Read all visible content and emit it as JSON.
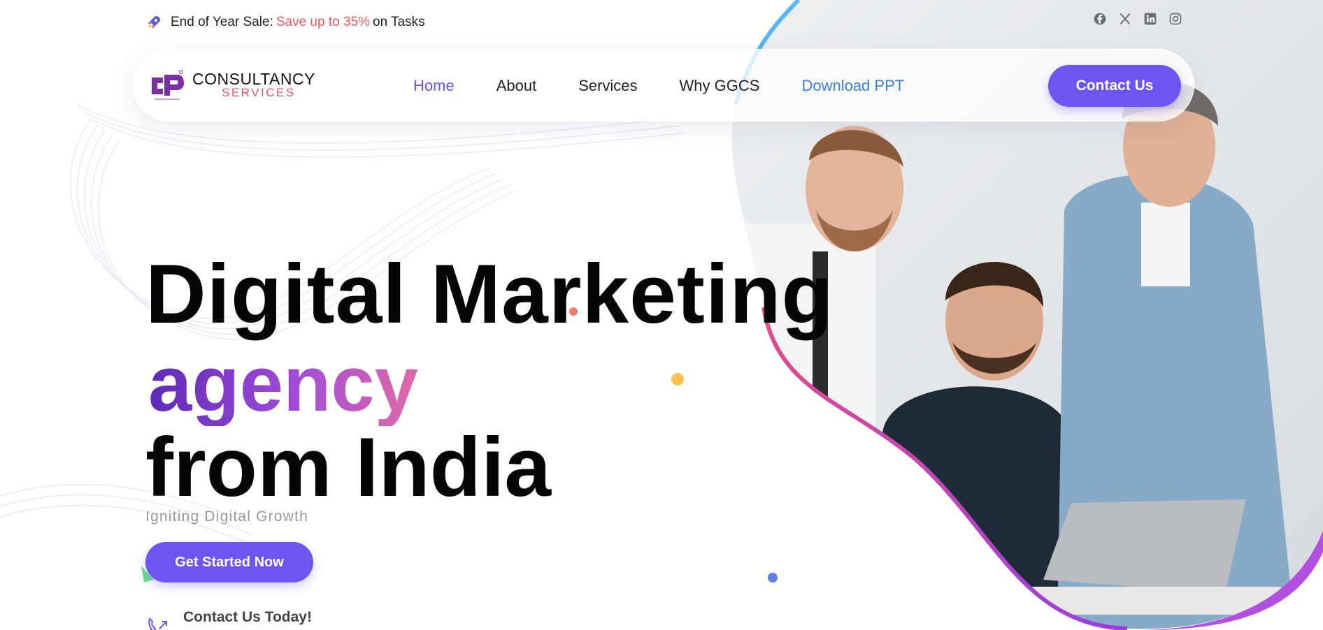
{
  "topbar": {
    "prefix": "End of Year Sale:",
    "highlight": "Save up to 35%",
    "suffix": "on Tasks"
  },
  "socials": [
    "facebook-icon",
    "x-icon",
    "linkedin-icon",
    "instagram-icon"
  ],
  "logo": {
    "line1": "CONSULTANCY",
    "line2": "SERVICES"
  },
  "nav": {
    "items": [
      "Home",
      "About",
      "Services",
      "Why GGCS",
      "Download PPT"
    ],
    "contact_label": "Contact Us"
  },
  "hero": {
    "line1": "Digital Marketing",
    "line2": "agency",
    "line3": "from India",
    "subtitle": "Igniting Digital Growth",
    "cta_label": "Get Started Now",
    "contact_today": "Contact Us Today!"
  },
  "colors": {
    "accent": "#6c55f0",
    "sale_highlight": "#f05a5a",
    "nav_active": "#6b55ee",
    "nav_ppt": "#3a7fe0",
    "logo_red": "#e2546e"
  }
}
